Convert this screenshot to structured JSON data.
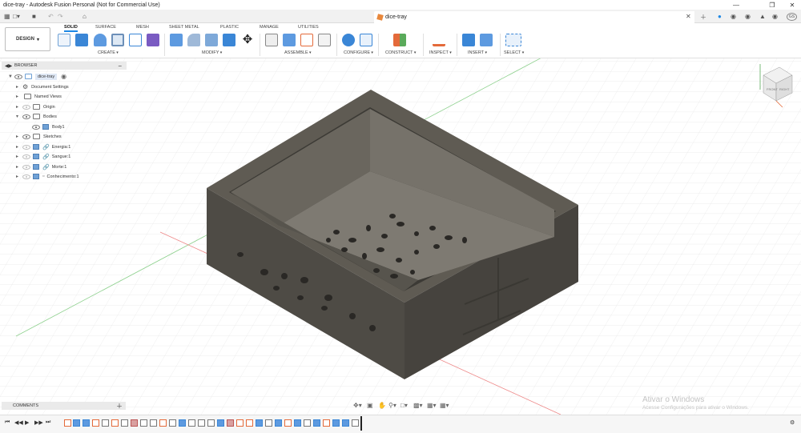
{
  "window": {
    "title": "dice-tray - Autodesk Fusion Personal (Not for Commercial Use)"
  },
  "tab": {
    "name": "dice-tray",
    "avatar": "GS"
  },
  "workspace": {
    "label": "DESIGN"
  },
  "ribbon_tabs": [
    "SOLID",
    "SURFACE",
    "MESH",
    "SHEET METAL",
    "PLASTIC",
    "MANAGE",
    "UTILITIES"
  ],
  "groups": [
    "CREATE",
    "MODIFY",
    "ASSEMBLE",
    "CONFIGURE",
    "CONSTRUCT",
    "INSPECT",
    "INSERT",
    "SELECT"
  ],
  "browser": {
    "title": "BROWSER",
    "root": "dice-tray",
    "items": [
      "Document Settings",
      "Named Views",
      "Origin",
      "Bodies",
      "Body1",
      "Sketches",
      "Energia:1",
      "Sangue:1",
      "Morte:1",
      "Conhecimento:1"
    ]
  },
  "comments": {
    "label": "COMMENTS"
  },
  "watermark": {
    "line1": "Ativar o Windows",
    "line2": "Acesse Configurações para ativar o Windows."
  },
  "viewcube": {
    "front": "FRONT",
    "right": "RIGHT"
  },
  "colors": {
    "accent": "#1e88e5",
    "model_top": "#5f5b53",
    "model_side": "#4b4842",
    "grid": "#d8d8d8"
  }
}
